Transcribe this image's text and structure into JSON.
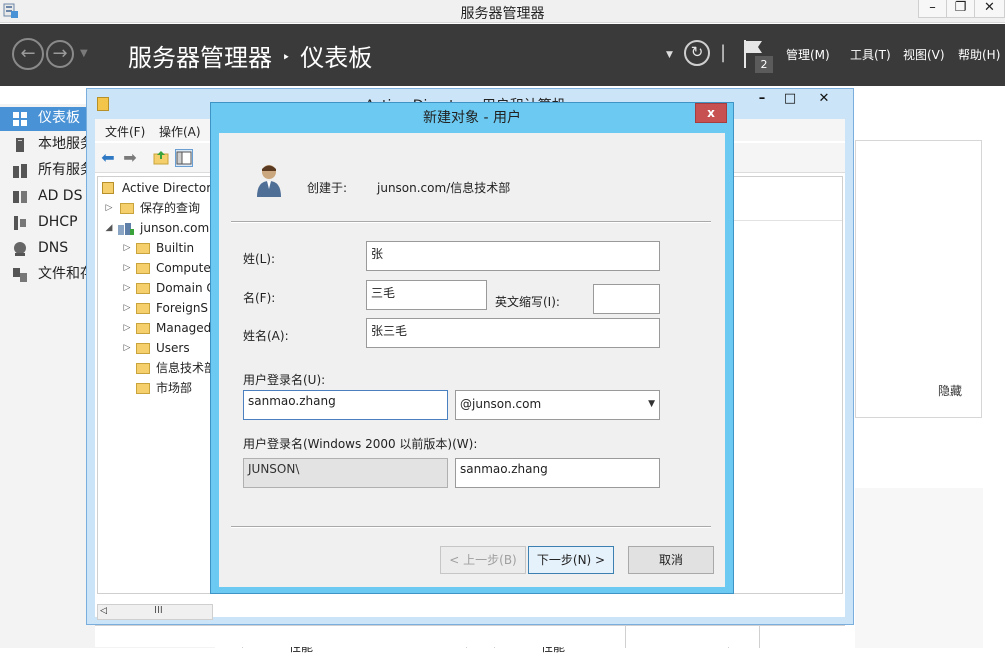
{
  "server_manager": {
    "window_title": "服务器管理器",
    "breadcrumb_root": "服务器管理器",
    "breadcrumb_sep": "‣",
    "breadcrumb_page": "仪表板",
    "header_menu": {
      "manage": "管理(M)",
      "tools": "工具(T)",
      "view": "视图(V)",
      "help": "帮助(H)"
    },
    "notification_count": "2",
    "sidebar": [
      {
        "label": "仪表板",
        "icon": "dashboard-icon",
        "active": true
      },
      {
        "label": "本地服务",
        "icon": "local-server-icon"
      },
      {
        "label": "所有服务",
        "icon": "all-servers-icon"
      },
      {
        "label": "AD DS",
        "icon": "ad-ds-icon"
      },
      {
        "label": "DHCP",
        "icon": "dhcp-icon"
      },
      {
        "label": "DNS",
        "icon": "dns-icon"
      },
      {
        "label": "文件和存",
        "icon": "file-storage-icon"
      }
    ],
    "hide_label": "隐藏",
    "perf_label_1": "性能",
    "perf_label_2": "性能"
  },
  "aduc": {
    "title": "Active Directory 用户和计算机",
    "menu": {
      "file": "文件(F)",
      "action": "操作(A)"
    },
    "tree": {
      "root": "Active Directory",
      "saved_queries": "保存的查询",
      "domain": "junson.com",
      "children": [
        "Builtin",
        "Compute",
        "Domain C",
        "ForeignS",
        "Managed",
        "Users",
        "信息技术部",
        "市场部"
      ]
    },
    "scroll_thumb": "III"
  },
  "dialog": {
    "title": "新建对象 - 用户",
    "close_label": "x",
    "created_in_label": "创建于:",
    "created_in_value": "junson.com/信息技术部",
    "last_name_label": "姓(L):",
    "last_name_value": "张",
    "first_name_label": "名(F):",
    "first_name_value": "三毛",
    "initials_label": "英文缩写(I):",
    "initials_value": "",
    "full_name_label": "姓名(A):",
    "full_name_value": "张三毛",
    "logon_name_label": "用户登录名(U):",
    "logon_name_value": "sanmao.zhang",
    "upn_suffix_value": "@junson.com",
    "pre2000_label": "用户登录名(Windows 2000 以前版本)(W):",
    "pre2000_domain_value": "JUNSON\\",
    "pre2000_name_value": "sanmao.zhang",
    "back_button": "< 上一步(B)",
    "next_button": "下一步(N) >",
    "cancel_button": "取消"
  },
  "colors": {
    "header_bg": "#3a3a3a",
    "sidebar_active": "#4a92d6",
    "dialog_frame": "#6ccaf2",
    "close_button": "#c75050"
  }
}
